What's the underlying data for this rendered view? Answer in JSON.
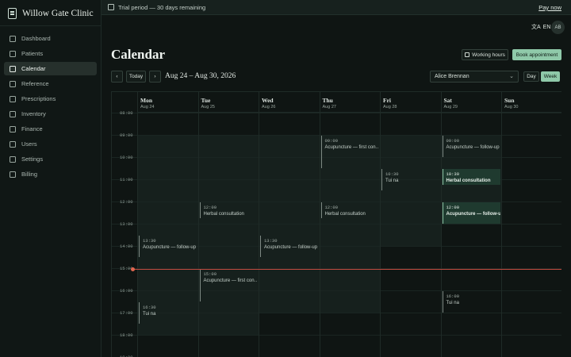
{
  "app": {
    "name": "Willow Gate Clinic"
  },
  "sidebar": {
    "items": [
      {
        "label": "Dashboard",
        "icon": "dashboard-icon"
      },
      {
        "label": "Patients",
        "icon": "patients-icon"
      },
      {
        "label": "Calendar",
        "icon": "calendar-icon",
        "active": true
      },
      {
        "label": "Reference",
        "icon": "book-icon"
      },
      {
        "label": "Prescriptions",
        "icon": "prescription-icon"
      },
      {
        "label": "Inventory",
        "icon": "inventory-icon"
      },
      {
        "label": "Finance",
        "icon": "finance-icon"
      },
      {
        "label": "Users",
        "icon": "users-icon"
      },
      {
        "label": "Settings",
        "icon": "gear-icon"
      },
      {
        "label": "Billing",
        "icon": "billing-icon"
      }
    ]
  },
  "banner": {
    "text": "Trial period — 30 days remaining",
    "action": "Pay now"
  },
  "topbar": {
    "language": "EN",
    "avatar_initials": "AB"
  },
  "page": {
    "title": "Calendar"
  },
  "toolbar": {
    "working_hours": "Working hours",
    "book": "Book appointment",
    "prev": "‹",
    "today": "Today",
    "next": "›",
    "range": "Aug 24 – Aug 30, 2026",
    "practitioner": "Alice Brennan",
    "view_day": "Day",
    "view_week": "Week"
  },
  "calendar": {
    "days": [
      {
        "name": "Mon",
        "date": "Aug 24"
      },
      {
        "name": "Tue",
        "date": "Aug 25"
      },
      {
        "name": "Wed",
        "date": "Aug 26"
      },
      {
        "name": "Thu",
        "date": "Aug 27"
      },
      {
        "name": "Fri",
        "date": "Aug 28"
      },
      {
        "name": "Sat",
        "date": "Aug 29"
      },
      {
        "name": "Sun",
        "date": "Aug 30"
      }
    ],
    "hours": [
      "08:00",
      "09:00",
      "10:00",
      "11:00",
      "12:00",
      "13:00",
      "14:00",
      "15:00",
      "16:00",
      "17:00",
      "18:00",
      "19:00"
    ],
    "now": "15:00",
    "events": [
      {
        "day": 0,
        "time": "13:30",
        "title": "Acupuncture — follow-up",
        "start": 13.5,
        "end": 14.5
      },
      {
        "day": 0,
        "time": "16:30",
        "title": "Tui na",
        "start": 16.5,
        "end": 17.5
      },
      {
        "day": 1,
        "time": "12:00",
        "title": "Herbal consultation",
        "start": 12,
        "end": 12.75
      },
      {
        "day": 1,
        "time": "15:00",
        "title": "Acupuncture — first con…",
        "start": 15,
        "end": 16.5
      },
      {
        "day": 2,
        "time": "13:30",
        "title": "Acupuncture — follow-up",
        "start": 13.5,
        "end": 14.5
      },
      {
        "day": 3,
        "time": "09:00",
        "title": "Acupuncture — first con…",
        "start": 9,
        "end": 10.5
      },
      {
        "day": 3,
        "time": "12:00",
        "title": "Herbal consultation",
        "start": 12,
        "end": 12.75
      },
      {
        "day": 4,
        "time": "10:30",
        "title": "Tui na",
        "start": 10.5,
        "end": 11.5
      },
      {
        "day": 5,
        "time": "09:00",
        "title": "Acupuncture — follow-up",
        "start": 9,
        "end": 10
      },
      {
        "day": 5,
        "time": "10:30",
        "title": "Herbal consultation",
        "start": 10.5,
        "end": 11.25,
        "highlight": true
      },
      {
        "day": 5,
        "time": "12:00",
        "title": "Acupuncture — follow-up",
        "start": 12,
        "end": 13,
        "highlight": true
      },
      {
        "day": 5,
        "time": "16:00",
        "title": "Tui na",
        "start": 16,
        "end": 17
      }
    ],
    "working_hours": [
      {
        "day": 0,
        "start": 9,
        "end": 18
      },
      {
        "day": 1,
        "start": 9,
        "end": 18
      },
      {
        "day": 2,
        "start": 9,
        "end": 17
      },
      {
        "day": 3,
        "start": 9,
        "end": 17
      },
      {
        "day": 4,
        "start": 9,
        "end": 14
      },
      {
        "day": 5,
        "start": 9,
        "end": 13
      }
    ]
  }
}
